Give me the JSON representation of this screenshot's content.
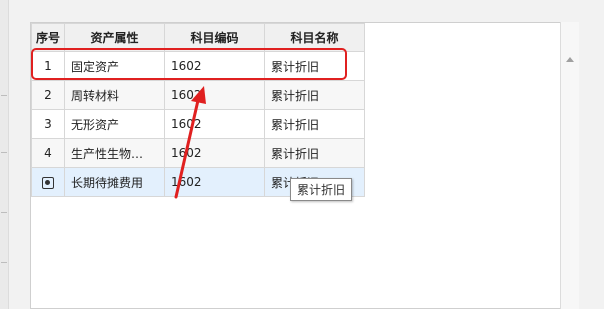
{
  "table": {
    "columns": {
      "seq": "序号",
      "attr": "资产属性",
      "code": "科目编码",
      "name": "科目名称"
    },
    "rows": [
      {
        "seq": "1",
        "attr": "固定资产",
        "code": "1602",
        "name": "累计折旧"
      },
      {
        "seq": "2",
        "attr": "周转材料",
        "code": "1602",
        "name": "累计折旧"
      },
      {
        "seq": "3",
        "attr": "无形资产",
        "code": "1602",
        "name": "累计折旧"
      },
      {
        "seq": "4",
        "attr": "生产性生物…",
        "code": "1602",
        "name": "累计折旧"
      },
      {
        "seq": "",
        "attr": "长期待摊费用",
        "code": "1602",
        "name": "累计折旧"
      }
    ],
    "selected_row_icon": "settings-icon"
  },
  "tooltip": {
    "text": "累计折旧"
  },
  "annotation": {
    "color": "#e02020"
  }
}
